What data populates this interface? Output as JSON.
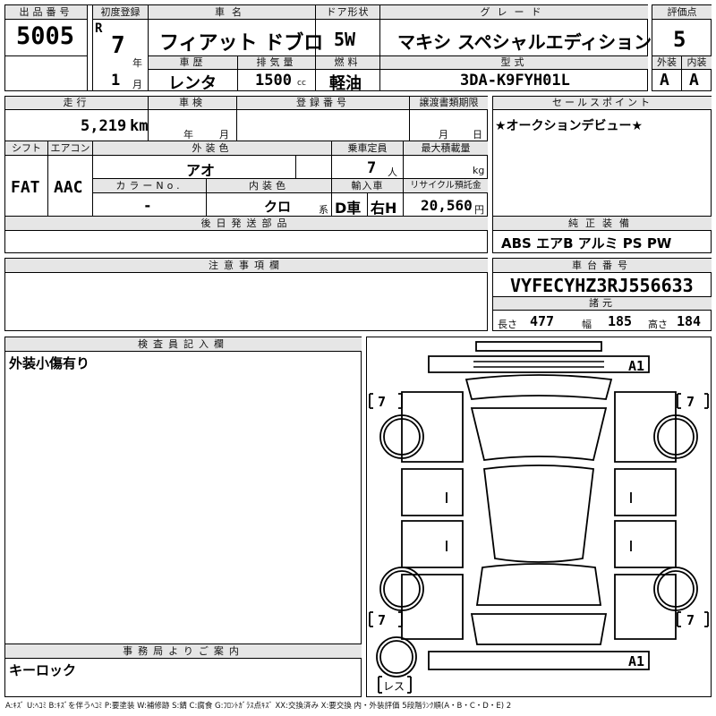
{
  "lot": {
    "label": "出品番号",
    "value": "5005"
  },
  "first_reg": {
    "label": "初度登録",
    "era": "R",
    "year": "7",
    "year_unit": "年",
    "month": "1",
    "month_unit": "月"
  },
  "car_name": {
    "label": "車名",
    "value": "フィアット ドブロ"
  },
  "doors": {
    "label": "ドア形状",
    "value": "5W"
  },
  "grade": {
    "label": "グレード",
    "value": "マキシ スペシャルエディション"
  },
  "score": {
    "label": "評価点",
    "value": "5"
  },
  "history": {
    "label": "車歴",
    "value": "レンタ"
  },
  "displacement": {
    "label": "排気量",
    "value": "1500",
    "unit": "cc"
  },
  "fuel": {
    "label": "燃料",
    "value": "軽油"
  },
  "model_code": {
    "label": "型式",
    "value": "3DA-K9FYH01L"
  },
  "ext_int": {
    "ext_label": "外装",
    "int_label": "内装",
    "ext_value": "A",
    "int_value": "A"
  },
  "mileage": {
    "label": "走行",
    "value": "5,219",
    "unit": "km"
  },
  "inspection": {
    "label": "車検",
    "year_unit": "年",
    "month_unit": "月"
  },
  "registration": {
    "label": "登録番号"
  },
  "transfer": {
    "label": "譲渡書類期限",
    "month_unit": "月",
    "day_unit": "日"
  },
  "sales_point": {
    "label": "セールスポイント",
    "value": "★オークションデビュー★"
  },
  "shift": {
    "label": "シフト",
    "value": "FAT"
  },
  "aircon": {
    "label": "エアコン",
    "value": "AAC"
  },
  "ext_color": {
    "label": "外装色",
    "value": "アオ"
  },
  "capacity": {
    "label": "乗車定員",
    "value": "7",
    "unit": "人"
  },
  "max_load": {
    "label": "最大積載量",
    "unit": "kg"
  },
  "color_no": {
    "label": "カラーNo.",
    "value": "-"
  },
  "int_color": {
    "label": "内装色",
    "value": "クロ",
    "unit": "系"
  },
  "import": {
    "label": "輸入車",
    "value1": "D車",
    "value2": "右H"
  },
  "recycle": {
    "label": "リサイクル預託金",
    "value": "20,560",
    "unit": "円"
  },
  "later_parts": {
    "label": "後日発送部品"
  },
  "equipment": {
    "label": "純正装備",
    "value": "ABS エアB アルミ PS PW"
  },
  "notes": {
    "label": "注意事項欄"
  },
  "chassis": {
    "label": "車台番号",
    "value": "VYFECYHZ3RJ556633"
  },
  "dims": {
    "label": "諸元",
    "len_label": "長さ",
    "len": "477",
    "wid_label": "幅",
    "wid": "185",
    "hgt_label": "高さ",
    "hgt": "184"
  },
  "inspector": {
    "label": "検査員記入欄",
    "value": "外装小傷有り"
  },
  "office": {
    "label": "事務局よりご案内",
    "value": "キーロック"
  },
  "diagram": {
    "tire_fl": "7",
    "tire_fr": "7",
    "tire_rl": "7",
    "tire_rr": "7",
    "mark_top": "A1",
    "mark_bottom": "A1",
    "spare": "レス"
  },
  "legend": "A:ｷｽﾞ U:ﾍｺﾐ B:ｷｽﾞを伴うﾍｺﾐ P:要塗装 W:補修跡 S:錆 C:腐食 G:ﾌﾛﾝﾄｶﾞﾗｽ点ｷｽﾞ XX:交換済み X:要交換  内・外装評価 5段階ﾗﾝｸ順(A・B・C・D・E) 2"
}
